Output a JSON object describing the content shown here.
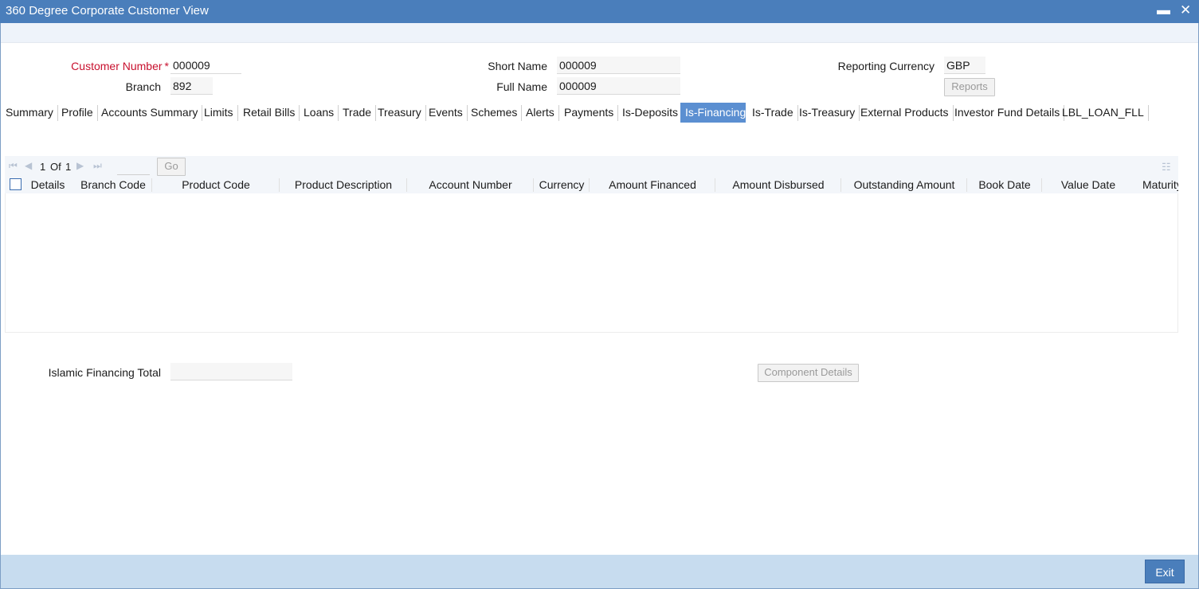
{
  "window": {
    "title": "360 Degree Corporate Customer View",
    "minimize": "▬",
    "close": "✕"
  },
  "form": {
    "customer_number_label": "Customer Number",
    "required_mark": "*",
    "customer_number": "000009",
    "branch_label": "Branch",
    "branch": "892",
    "short_name_label": "Short Name",
    "short_name": "000009",
    "full_name_label": "Full Name",
    "full_name": "000009",
    "reporting_currency_label": "Reporting Currency",
    "reporting_currency": "GBP",
    "reports_button": "Reports"
  },
  "tabs": [
    {
      "label": "Summary"
    },
    {
      "label": "Profile"
    },
    {
      "label": "Accounts Summary"
    },
    {
      "label": "Limits"
    },
    {
      "label": "Retail Bills"
    },
    {
      "label": "Loans"
    },
    {
      "label": "Trade"
    },
    {
      "label": "Treasury"
    },
    {
      "label": "Events"
    },
    {
      "label": "Schemes"
    },
    {
      "label": "Alerts"
    },
    {
      "label": "Payments"
    },
    {
      "label": "Is-Deposits"
    },
    {
      "label": "Is-Financing"
    },
    {
      "label": "Is-Trade"
    },
    {
      "label": "Is-Treasury"
    },
    {
      "label": "External Products"
    },
    {
      "label": "Investor Fund Details"
    },
    {
      "label": "LBL_LOAN_FLL"
    }
  ],
  "active_tab": "Is-Financing",
  "pager": {
    "current": "1",
    "of_label": "Of",
    "total": "1",
    "go": "Go"
  },
  "table": {
    "columns": [
      "Details",
      "Branch Code",
      "Product Code",
      "Product Description",
      "Account Number",
      "Currency",
      "Amount Financed",
      "Amount Disbursed",
      "Outstanding Amount",
      "Book Date",
      "Value Date",
      "Maturity"
    ]
  },
  "totals": {
    "islamic_financing_total_label": "Islamic Financing Total",
    "islamic_financing_total": "",
    "component_details_button": "Component Details"
  },
  "footer": {
    "exit_button": "Exit"
  },
  "colors": {
    "titlebar": "#4a7ebb",
    "active_tab": "#5b8fd1",
    "footer": "#c7dcef",
    "required": "#c8102e"
  }
}
